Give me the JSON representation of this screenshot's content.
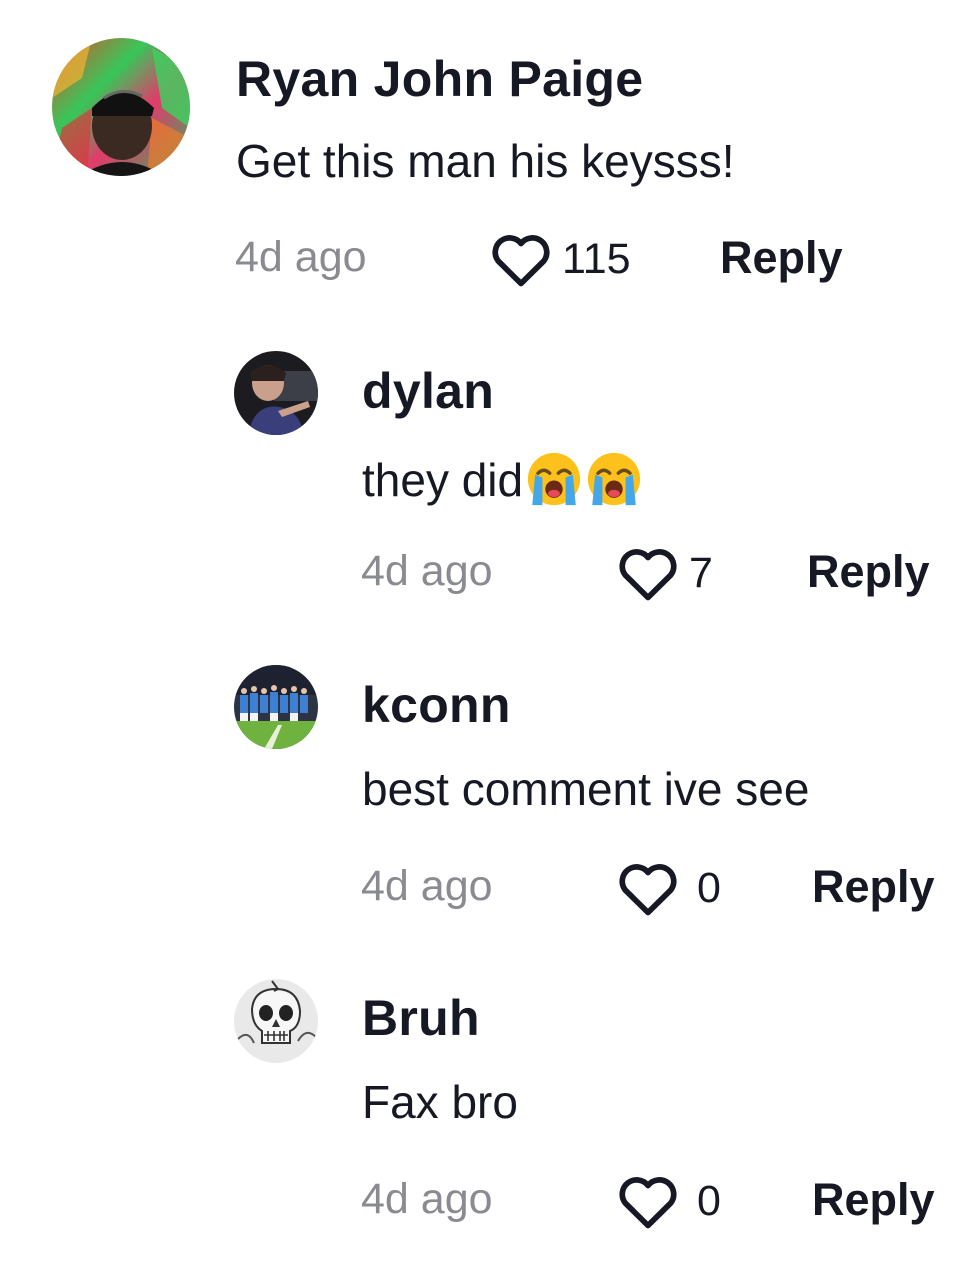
{
  "comments": [
    {
      "username": "Ryan John Paige",
      "text": "Get this man his keysss!",
      "time": "4d ago",
      "likes": "115",
      "reply_label": "Reply",
      "avatar": "avatar-colorful-cap"
    },
    {
      "username": "dylan",
      "text": "they did",
      "emoji": [
        "loudly-crying-face-emoji",
        "loudly-crying-face-emoji"
      ],
      "time": "4d ago",
      "likes": "7",
      "reply_label": "Reply",
      "avatar": "avatar-dark-car"
    },
    {
      "username": "kconn",
      "text": "best comment ive see",
      "time": "4d ago",
      "likes": "0",
      "reply_label": "Reply",
      "avatar": "avatar-team-field"
    },
    {
      "username": "Bruh",
      "text": "Fax bro",
      "time": "4d ago",
      "likes": "0",
      "reply_label": "Reply",
      "avatar": "avatar-skull-sketch"
    }
  ],
  "colors": {
    "text": "#161823",
    "muted": "#8a8b91",
    "background": "#ffffff"
  },
  "icons": {
    "like": "heart-outline-icon"
  }
}
